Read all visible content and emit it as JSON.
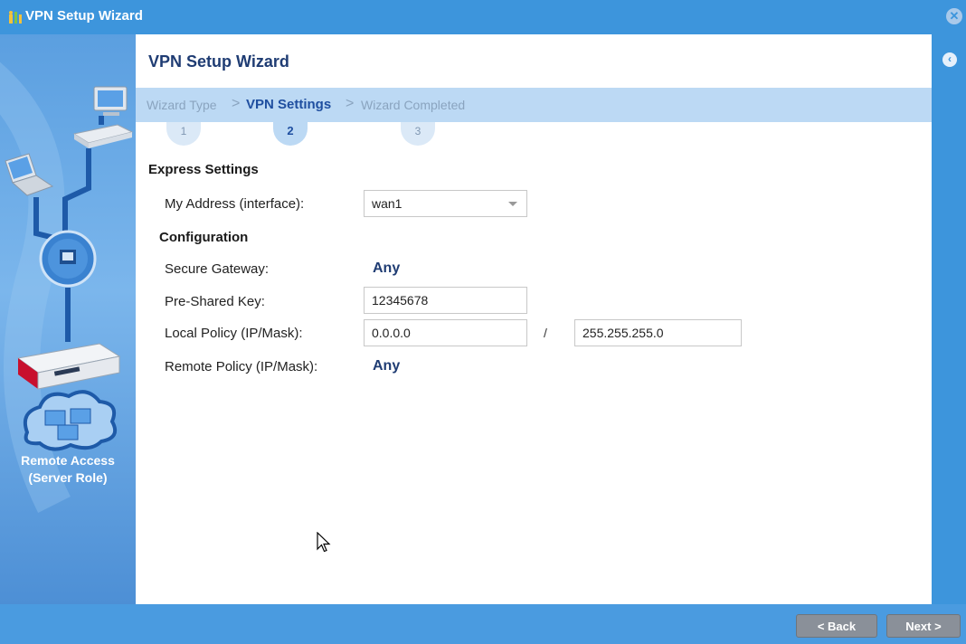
{
  "window": {
    "title": "VPN Setup Wizard"
  },
  "sidebar": {
    "role_label_line1": "Remote Access",
    "role_label_line2": "(Server Role)"
  },
  "content": {
    "title": "VPN Setup Wizard",
    "steps": [
      {
        "label": "Wizard Type",
        "number": "1"
      },
      {
        "label": "VPN Settings",
        "number": "2"
      },
      {
        "label": "Wizard Completed",
        "number": "3"
      }
    ],
    "step_separator": ">",
    "express": {
      "title": "Express Settings",
      "my_address_label": "My Address (interface):",
      "my_address_value": "wan1"
    },
    "configuration": {
      "title": "Configuration",
      "secure_gateway_label": "Secure Gateway:",
      "secure_gateway_value": "Any",
      "psk_label": "Pre-Shared Key:",
      "psk_value": "12345678",
      "local_policy_label": "Local Policy (IP/Mask):",
      "local_policy_ip": "0.0.0.0",
      "local_policy_separator": "/",
      "local_policy_mask": "255.255.255.0",
      "remote_policy_label": "Remote Policy (IP/Mask):",
      "remote_policy_value": "Any"
    }
  },
  "footer": {
    "back_label": "< Back",
    "next_label": "Next >"
  },
  "colors": {
    "titlebar": "#3d95dc",
    "accent_text": "#1f3c73",
    "steps_bar": "#bcd9f4",
    "button": "#8a9099"
  }
}
